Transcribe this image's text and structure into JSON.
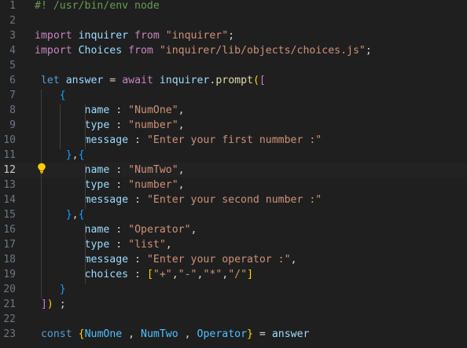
{
  "editor": {
    "current_line": 12,
    "lines": [
      {
        "num": "1",
        "tokens": [
          {
            "t": "#! /usr/bin/env node",
            "c": "comment"
          }
        ]
      },
      {
        "num": "2",
        "tokens": []
      },
      {
        "num": "3",
        "tokens": [
          {
            "t": "import",
            "c": "keyword"
          },
          {
            "t": " inquirer ",
            "c": "ident"
          },
          {
            "t": "from",
            "c": "keyword"
          },
          {
            "t": " ",
            "c": "plain"
          },
          {
            "t": "\"inquirer\"",
            "c": "string"
          },
          {
            "t": ";",
            "c": "plain"
          }
        ]
      },
      {
        "num": "4",
        "tokens": [
          {
            "t": "import",
            "c": "keyword"
          },
          {
            "t": " Choices ",
            "c": "ident"
          },
          {
            "t": "from",
            "c": "keyword"
          },
          {
            "t": " ",
            "c": "plain"
          },
          {
            "t": "\"inquirer/lib/objects/choices.js\"",
            "c": "string"
          },
          {
            "t": ";",
            "c": "plain"
          }
        ]
      },
      {
        "num": "5",
        "tokens": []
      },
      {
        "num": "6",
        "tokens": [
          {
            "t": " ",
            "c": "plain"
          },
          {
            "t": "let",
            "c": "storage"
          },
          {
            "t": " answer",
            "c": "ident"
          },
          {
            "t": " = ",
            "c": "plain"
          },
          {
            "t": "await",
            "c": "keyword"
          },
          {
            "t": " inquirer",
            "c": "ident"
          },
          {
            "t": ".",
            "c": "plain"
          },
          {
            "t": "prompt",
            "c": "func"
          },
          {
            "t": "(",
            "c": "b1"
          },
          {
            "t": "[",
            "c": "b2"
          }
        ]
      },
      {
        "num": "7",
        "tokens": [
          {
            "t": "    ",
            "c": "plain"
          },
          {
            "t": "{",
            "c": "b3"
          }
        ]
      },
      {
        "num": "8",
        "tokens": [
          {
            "t": "        ",
            "c": "plain"
          },
          {
            "t": "name",
            "c": "ident"
          },
          {
            "t": " : ",
            "c": "plain"
          },
          {
            "t": "\"NumOne\"",
            "c": "string"
          },
          {
            "t": ",",
            "c": "plain"
          }
        ]
      },
      {
        "num": "9",
        "tokens": [
          {
            "t": "        ",
            "c": "plain"
          },
          {
            "t": "type",
            "c": "ident"
          },
          {
            "t": " : ",
            "c": "plain"
          },
          {
            "t": "\"number\"",
            "c": "string"
          },
          {
            "t": ",",
            "c": "plain"
          }
        ]
      },
      {
        "num": "10",
        "tokens": [
          {
            "t": "        ",
            "c": "plain"
          },
          {
            "t": "message",
            "c": "ident"
          },
          {
            "t": " : ",
            "c": "plain"
          },
          {
            "t": "\"Enter your first nummber :\"",
            "c": "string"
          }
        ]
      },
      {
        "num": "11",
        "tokens": [
          {
            "t": "     ",
            "c": "plain"
          },
          {
            "t": "}",
            "c": "b3"
          },
          {
            "t": ",",
            "c": "plain"
          },
          {
            "t": "{",
            "c": "b3"
          }
        ]
      },
      {
        "num": "12",
        "tokens": [
          {
            "t": "        ",
            "c": "plain"
          },
          {
            "t": "name",
            "c": "ident"
          },
          {
            "t": " : ",
            "c": "plain"
          },
          {
            "t": "\"NumTwo\"",
            "c": "string"
          },
          {
            "t": ",",
            "c": "plain"
          }
        ]
      },
      {
        "num": "13",
        "tokens": [
          {
            "t": "        ",
            "c": "plain"
          },
          {
            "t": "type",
            "c": "ident"
          },
          {
            "t": " : ",
            "c": "plain"
          },
          {
            "t": "\"number\"",
            "c": "string"
          },
          {
            "t": ",",
            "c": "plain"
          }
        ]
      },
      {
        "num": "14",
        "tokens": [
          {
            "t": "        ",
            "c": "plain"
          },
          {
            "t": "message",
            "c": "ident"
          },
          {
            "t": " : ",
            "c": "plain"
          },
          {
            "t": "\"Enter your second number :\"",
            "c": "string"
          }
        ]
      },
      {
        "num": "15",
        "tokens": [
          {
            "t": "     ",
            "c": "plain"
          },
          {
            "t": "}",
            "c": "b3"
          },
          {
            "t": ",",
            "c": "plain"
          },
          {
            "t": "{",
            "c": "b3"
          }
        ]
      },
      {
        "num": "16",
        "tokens": [
          {
            "t": "        ",
            "c": "plain"
          },
          {
            "t": "name",
            "c": "ident"
          },
          {
            "t": " : ",
            "c": "plain"
          },
          {
            "t": "\"Operator\"",
            "c": "string"
          },
          {
            "t": ",",
            "c": "plain"
          }
        ]
      },
      {
        "num": "17",
        "tokens": [
          {
            "t": "        ",
            "c": "plain"
          },
          {
            "t": "type",
            "c": "ident"
          },
          {
            "t": " : ",
            "c": "plain"
          },
          {
            "t": "\"list\"",
            "c": "string"
          },
          {
            "t": ",",
            "c": "plain"
          }
        ]
      },
      {
        "num": "18",
        "tokens": [
          {
            "t": "        ",
            "c": "plain"
          },
          {
            "t": "message",
            "c": "ident"
          },
          {
            "t": " : ",
            "c": "plain"
          },
          {
            "t": "\"Enter your operator :\"",
            "c": "string"
          },
          {
            "t": ",",
            "c": "plain"
          }
        ]
      },
      {
        "num": "19",
        "tokens": [
          {
            "t": "        ",
            "c": "plain"
          },
          {
            "t": "choices",
            "c": "ident"
          },
          {
            "t": " : ",
            "c": "plain"
          },
          {
            "t": "[",
            "c": "b1"
          },
          {
            "t": "\"+\"",
            "c": "string"
          },
          {
            "t": ",",
            "c": "plain"
          },
          {
            "t": "\"-\"",
            "c": "string"
          },
          {
            "t": ",",
            "c": "plain"
          },
          {
            "t": "\"*\"",
            "c": "string"
          },
          {
            "t": ",",
            "c": "plain"
          },
          {
            "t": "\"/\"",
            "c": "string"
          },
          {
            "t": "]",
            "c": "b1"
          }
        ]
      },
      {
        "num": "20",
        "tokens": [
          {
            "t": "    ",
            "c": "plain"
          },
          {
            "t": "}",
            "c": "b3"
          }
        ]
      },
      {
        "num": "21",
        "tokens": [
          {
            "t": " ",
            "c": "plain"
          },
          {
            "t": "]",
            "c": "b2"
          },
          {
            "t": ")",
            "c": "b1"
          },
          {
            "t": " ;",
            "c": "plain"
          }
        ]
      },
      {
        "num": "22",
        "tokens": []
      },
      {
        "num": "23",
        "tokens": [
          {
            "t": " ",
            "c": "plain"
          },
          {
            "t": "const",
            "c": "storage"
          },
          {
            "t": " ",
            "c": "plain"
          },
          {
            "t": "{",
            "c": "b1"
          },
          {
            "t": "NumOne",
            "c": "const"
          },
          {
            "t": " , ",
            "c": "plain"
          },
          {
            "t": "NumTwo",
            "c": "const"
          },
          {
            "t": " , ",
            "c": "plain"
          },
          {
            "t": "Operator",
            "c": "const"
          },
          {
            "t": "}",
            "c": "b1"
          },
          {
            "t": " = ",
            "c": "plain"
          },
          {
            "t": "answer",
            "c": "ident"
          }
        ]
      }
    ]
  },
  "lightbulb": {
    "icon": "lightbulb-icon",
    "color": "#ffcc00",
    "line": 12
  }
}
